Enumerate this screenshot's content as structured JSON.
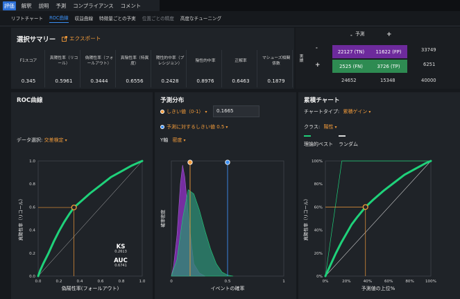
{
  "nav": {
    "items": [
      "評価",
      "解釈",
      "説明",
      "予測",
      "コンプライアンス",
      "コメント"
    ],
    "active": 0
  },
  "subnav": {
    "items": [
      "リフトチャート",
      "ROC曲線",
      "収益曲線",
      "特徴量ごとの予実",
      "位置ごとの精度",
      "高度なチューニング"
    ],
    "active": 1,
    "dim": 4
  },
  "summary": {
    "title": "選択サマリー",
    "export_label": "エクスポート",
    "metrics": [
      {
        "label": "F1スコア",
        "value": "0.345"
      },
      {
        "label": "真陽性率（リコール）",
        "value": "0.5961"
      },
      {
        "label": "偽陽性率（フォールアウト）",
        "value": "0.3444"
      },
      {
        "label": "真陰性率（特異度）",
        "value": "0.6556"
      },
      {
        "label": "陽性的中率（プレシジョン）",
        "value": "0.2428"
      },
      {
        "label": "陰性的中率",
        "value": "0.8976"
      },
      {
        "label": "正解率",
        "value": "0.6463"
      },
      {
        "label": "マシューズ相関係数",
        "value": "0.1879"
      }
    ]
  },
  "confusion": {
    "predicted_label": "予測",
    "actual_label": "実績",
    "minus": "-",
    "plus": "+",
    "tn": "22127 (TN)",
    "fp": "11622 (FP)",
    "fn": "2525 (FN)",
    "tp": "3726 (TP)",
    "row_total_neg": "33749",
    "row_total_pos": "6251",
    "col_total_neg": "24652",
    "col_total_pos": "15348",
    "grand_total": "40000"
  },
  "roc": {
    "title": "ROC曲線",
    "data_select_label": "データ選択:",
    "data_select_value": "交差検定",
    "ylabel": "真陽性率（リコール）",
    "xlabel": "偽陽性率(フォールアウト)",
    "ks_label": "KS",
    "ks_value": "0.2613",
    "auc_label": "AUC",
    "auc_value": "0.6741"
  },
  "dist": {
    "title": "予測分布",
    "threshold_label": "しきい値（0-1）",
    "threshold_value": "0.1665",
    "pred_threshold_label": "予測に対するしきい値 0.5",
    "yaxis_label": "Y軸",
    "yaxis_value": "密度",
    "ylabel": "確率密度",
    "xlabel": "イベントの確率"
  },
  "cum": {
    "title": "累積チャート",
    "chart_type_label": "チャートタイプ:",
    "chart_type_value": "累積ゲイン",
    "class_label": "クラス:",
    "class_value": "陽性",
    "legend_ideal": "理論的ベスト",
    "legend_random": "ランダム",
    "ylabel": "真陽性率（リコール）",
    "xlabel": "予測値の上位%"
  },
  "colors": {
    "accent": "#f29b3a",
    "green": "#1fd17a",
    "purple": "#7b2fa8",
    "teal": "#2e8b73",
    "blue": "#3b8ef0"
  },
  "chart_data": [
    {
      "type": "line",
      "title": "ROC曲線",
      "xlabel": "偽陽性率(フォールアウト)",
      "ylabel": "真陽性率（リコール）",
      "xlim": [
        0,
        1
      ],
      "ylim": [
        0,
        1
      ],
      "x_ticks": [
        "0.0",
        "0.2",
        "0.4",
        "0.6",
        "0.8",
        "1.0"
      ],
      "y_ticks": [
        "0.0",
        "0.2",
        "0.4",
        "0.6",
        "0.8",
        "1.0"
      ],
      "series": [
        {
          "x": [
            0,
            0.02,
            0.05,
            0.1,
            0.15,
            0.2,
            0.25,
            0.3,
            0.3444,
            0.4,
            0.5,
            0.6,
            0.7,
            0.8,
            0.9,
            1.0
          ],
          "y": [
            0,
            0.05,
            0.11,
            0.2,
            0.3,
            0.39,
            0.47,
            0.54,
            0.5961,
            0.64,
            0.72,
            0.79,
            0.86,
            0.91,
            0.96,
            1.0
          ]
        }
      ],
      "selected_point": {
        "x": 0.3444,
        "y": 0.5961
      }
    },
    {
      "type": "area",
      "title": "予測分布",
      "xlabel": "イベントの確率",
      "ylabel": "確率密度",
      "xlim": [
        0,
        1
      ],
      "x_ticks": [
        "0",
        "0.5",
        "1"
      ],
      "series": [
        {
          "x": [
            0,
            0.02,
            0.05,
            0.08,
            0.1,
            0.12,
            0.15,
            0.18,
            0.2,
            0.25,
            0.3
          ],
          "y": [
            0,
            0.5,
            2.0,
            4.5,
            5.4,
            4.8,
            3.0,
            1.5,
            0.6,
            0.15,
            0
          ]
        },
        {
          "x": [
            0,
            0.05,
            0.1,
            0.15,
            0.2,
            0.25,
            0.3,
            0.35,
            0.4,
            0.45,
            0.5,
            0.55
          ],
          "y": [
            0,
            0.8,
            2.8,
            4.2,
            4.0,
            3.2,
            2.2,
            1.3,
            0.6,
            0.2,
            0.05,
            0
          ]
        }
      ],
      "threshold": 0.1665,
      "prediction_threshold": 0.5
    },
    {
      "type": "line",
      "title": "累積チャート",
      "xlabel": "予測値の上位%",
      "ylabel": "真陽性率（リコール）",
      "xlim": [
        0,
        100
      ],
      "ylim": [
        0,
        100
      ],
      "x_ticks": [
        "0%",
        "20%",
        "40%",
        "60%",
        "80%",
        "100%"
      ],
      "y_ticks": [
        "0%",
        "20%",
        "40%",
        "60%",
        "80%",
        "100%"
      ],
      "series": [
        {
          "name": "",
          "x": [
            0,
            5,
            10,
            15,
            20,
            25,
            30,
            38,
            45,
            55,
            65,
            75,
            85,
            95,
            100
          ],
          "y": [
            0,
            10,
            20,
            29,
            37,
            45,
            51,
            60,
            66,
            74,
            81,
            88,
            93,
            98,
            100
          ]
        },
        {
          "name": "理論的ベスト",
          "x": [
            0,
            15.6,
            100
          ],
          "y": [
            0,
            100,
            100
          ]
        },
        {
          "name": "ランダム",
          "x": [
            0,
            100
          ],
          "y": [
            0,
            100
          ]
        }
      ],
      "selected_point": {
        "x": 38,
        "y": 60
      }
    }
  ]
}
